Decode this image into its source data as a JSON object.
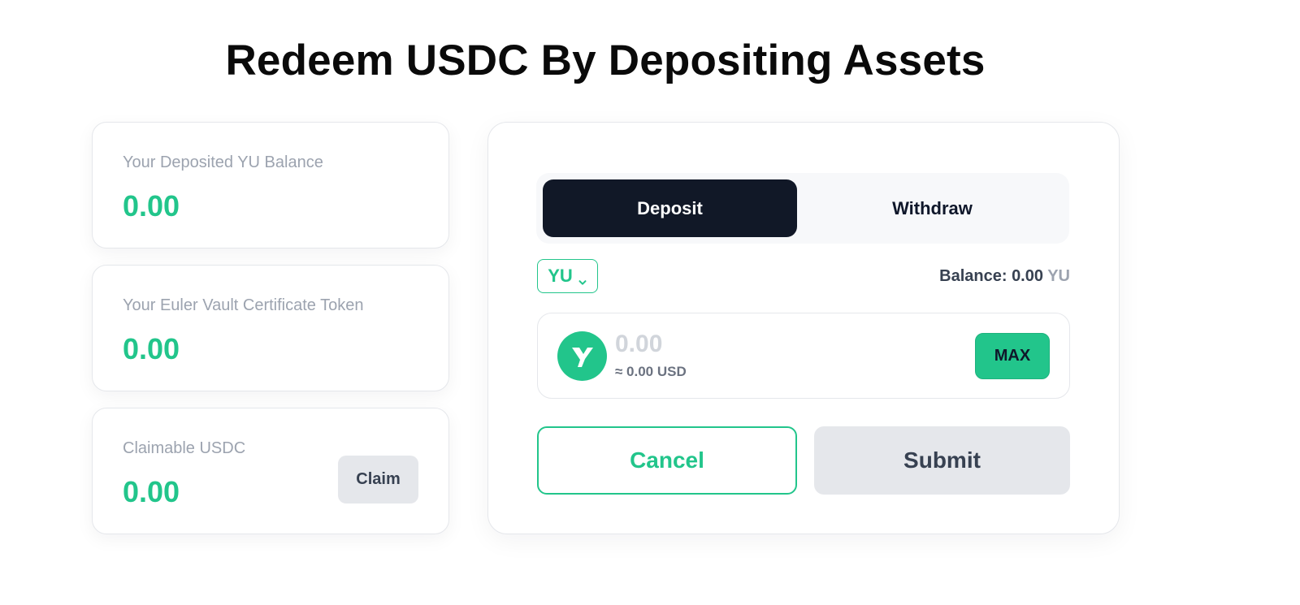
{
  "page": {
    "title": "Redeem USDC By Depositing Assets"
  },
  "stats": [
    {
      "label": "Your Deposited YU Balance",
      "value": "0.00"
    },
    {
      "label": "Your Euler Vault Certificate Token",
      "value": "0.00"
    },
    {
      "label": "Claimable USDC",
      "value": "0.00",
      "action_label": "Claim"
    }
  ],
  "form": {
    "tabs": [
      {
        "label": "Deposit",
        "active": true
      },
      {
        "label": "Withdraw",
        "active": false
      }
    ],
    "token_select": {
      "selected": "YU",
      "icon": "chevron-down-icon"
    },
    "balance": {
      "label": "Balance:",
      "value": "0.00",
      "unit": "YU"
    },
    "amount": {
      "value": "",
      "placeholder": "0.00",
      "usd_estimate": "≈ 0.00 USD",
      "token_icon": "yu-token-logo-icon",
      "max_label": "MAX"
    },
    "cancel_label": "Cancel",
    "submit_label": "Submit"
  },
  "colors": {
    "accent": "#22c58b",
    "dark_tab": "#111827",
    "muted_text": "#9ca3af",
    "disabled_button": "#e5e7eb"
  }
}
